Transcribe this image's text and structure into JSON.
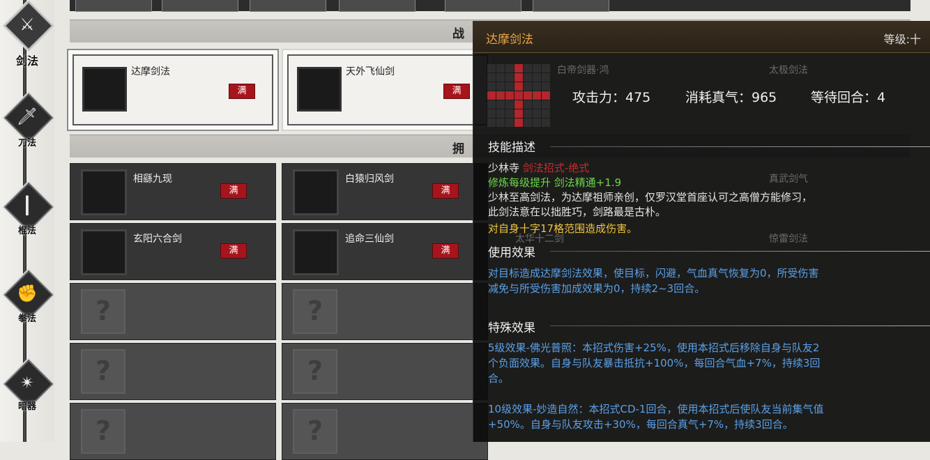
{
  "nav": {
    "items": [
      {
        "label": "剑法",
        "icon": "crossed-swords-icon"
      },
      {
        "label": "刀法",
        "icon": "blade-icon"
      },
      {
        "label": "棍法",
        "icon": "staff-icon"
      },
      {
        "label": "拳法",
        "icon": "fist-icon"
      },
      {
        "label": "暗器",
        "icon": "hidden-weapon-icon"
      }
    ]
  },
  "headers": {
    "equipped": "战",
    "owned": "拥"
  },
  "equipped": [
    {
      "name": "达摩剑法",
      "badge": "满",
      "art": "gold"
    },
    {
      "name": "天外飞仙剑",
      "badge": "满",
      "art": "red"
    }
  ],
  "owned": [
    {
      "name": "相繇九现",
      "badge": "满",
      "art": "gold"
    },
    {
      "name": "白猿归风剑",
      "badge": "满",
      "art": "gold"
    },
    {
      "name": "玄阳六合剑",
      "badge": "满",
      "art": "gold"
    },
    {
      "name": "追命三仙剑",
      "badge": "满",
      "art": "yellow"
    }
  ],
  "locked_symbol": "?",
  "tooltip": {
    "skill_name": "达摩剑法",
    "level": "等级:十",
    "background_hints": [
      "白帝剑器·鸿",
      "太极剑法",
      "真武剑气",
      "太华十二剑",
      "惊雷剑法"
    ],
    "range_pattern": [
      "0001000",
      "0001000",
      "0001000",
      "1111111",
      "0001000",
      "0001000",
      "0001000"
    ],
    "stats": {
      "attack": "攻击力：475",
      "consume": "消耗真气：965",
      "cooldown": "等待回合：4"
    },
    "desc_title": "技能描述",
    "school": "少林寺",
    "skill_type": "剑法招式-绝式",
    "train_bonus": "修炼每级提升 剑法精通+1.9",
    "desc_lines": [
      "少林至高剑法，为达摩祖师亲创，仅罗汉堂首座认可之高僧方能修习，",
      "此剑法意在以拙胜巧，剑路最是古朴。"
    ],
    "range_text": "对自身十字17格范围造成伤害。",
    "use_title": "使用效果",
    "use_lines": [
      "对目标造成达摩剑法效果，使目标，闪避，气血真气恢复为0，所受伤害",
      "减免与所受伤害加成效果为0，持续2~3回合。"
    ],
    "special_title": "特殊效果",
    "special5_lines": [
      "5级效果-佛光普照：本招式伤害+25%，使用本招式后移除自身与队友2",
      "个负面效果。自身与队友暴击抵抗+100%，每回合气血+7%，持续3回",
      "合。"
    ],
    "special10_lines": [
      "10级效果-妙造自然：本招式CD-1回合，使用本招式后使队友当前集气值",
      "+50%。自身与队友攻击+30%，每回合真气+7%，持续3回合。"
    ]
  },
  "colors": {
    "accent_gold": "#e8a64a",
    "badge_red": "#a8141c",
    "range_hit": "#b3262b",
    "effect_blue": "#5aa0e8",
    "bonus_green": "#6bd84a"
  }
}
